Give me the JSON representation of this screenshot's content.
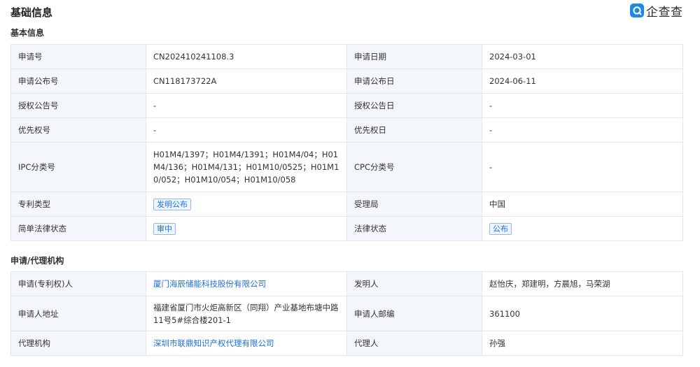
{
  "header": {
    "title": "基础信息",
    "logo_text": "企查查",
    "logo_icon": "qcc-logo-icon"
  },
  "basic": {
    "section_title": "基本信息",
    "rows": [
      {
        "l1": "申请号",
        "v1": "CN202410241108.3",
        "l2": "申请日期",
        "v2": "2024-03-01"
      },
      {
        "l1": "申请公布号",
        "v1": "CN118173722A",
        "l2": "申请公布日",
        "v2": "2024-06-11"
      },
      {
        "l1": "授权公告号",
        "v1": "-",
        "l2": "授权公告日",
        "v2": "-"
      },
      {
        "l1": "优先权号",
        "v1": "-",
        "l2": "优先权日",
        "v2": "-"
      },
      {
        "l1": "IPC分类号",
        "v1": "H01M4/1397；H01M4/1391；H01M4/04；H01M4/136；H01M4/131；H01M10/0525；H01M10/052；H01M10/054；H01M10/058",
        "l2": "CPC分类号",
        "v2": "-"
      },
      {
        "l1": "专利类型",
        "v1": "发明公布",
        "l2": "受理局",
        "v2": "中国"
      },
      {
        "l1": "简单法律状态",
        "v1": "审中",
        "l2": "法律状态",
        "v2": "公布"
      }
    ]
  },
  "agency": {
    "section_title": "申请/代理机构",
    "rows": [
      {
        "l1": "申请(专利权)人",
        "v1": "厦门海辰储能科技股份有限公司",
        "l2": "发明人",
        "v2": "赵怡庆，郑建明，方晨旭，马荣湖"
      },
      {
        "l1": "申请人地址",
        "v1": "福建省厦门市火炬高新区（同翔）产业基地布塘中路11号5#综合楼201-1",
        "l2": "申请人邮编",
        "v2": "361100"
      },
      {
        "l1": "代理机构",
        "v1": "深圳市联鼎知识产权代理有限公司",
        "l2": "代理人",
        "v2": "孙强"
      }
    ]
  },
  "colors": {
    "label_bg": "#f3f7fc",
    "border": "#e4e6eb",
    "link": "#1f6fd6",
    "logo_blue": "#1e88e5"
  }
}
